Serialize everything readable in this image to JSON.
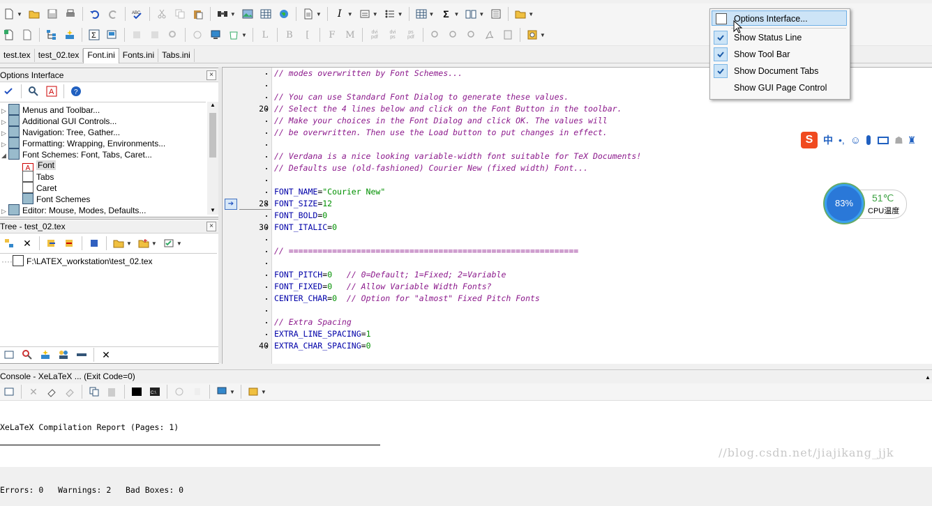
{
  "tabs": [
    {
      "label": "test.tex"
    },
    {
      "label": "test_02.tex"
    },
    {
      "label": "Font.ini",
      "active": true
    },
    {
      "label": "Fonts.ini"
    },
    {
      "label": "Tabs.ini"
    }
  ],
  "options_panel": {
    "title": "Options Interface",
    "items": [
      {
        "label": "Menus and Toolbar..."
      },
      {
        "label": "Additional GUI Controls..."
      },
      {
        "label": "Navigation: Tree, Gather..."
      },
      {
        "label": "Formatting: Wrapping, Environments..."
      },
      {
        "label": "Font Schemes: Font, Tabs, Caret..."
      },
      {
        "label": "Font"
      },
      {
        "label": "Tabs"
      },
      {
        "label": "Caret"
      },
      {
        "label": "Font Schemes"
      },
      {
        "label": "Editor: Mouse, Modes, Defaults..."
      }
    ]
  },
  "tree_panel": {
    "title": "Tree - test_02.tex",
    "file": "F:\\LATEX_workstation\\test_02.tex"
  },
  "editor": {
    "line_numbers": [
      "20",
      "28",
      "30",
      "40"
    ],
    "lines": [
      {
        "type": "comment",
        "text": "// modes overwritten by Font Schemes..."
      },
      {
        "type": "blank",
        "text": ""
      },
      {
        "type": "comment",
        "text": "// You can use Standard Font Dialog to generate these values."
      },
      {
        "type": "comment",
        "text": "// Select the 4 lines below and click on the Font Button in the toolbar."
      },
      {
        "type": "comment",
        "text": "// Make your choices in the Font Dialog and click OK. The values will"
      },
      {
        "type": "comment",
        "text": "// be overwritten. Then use the Load button to put changes in effect."
      },
      {
        "type": "blank",
        "text": ""
      },
      {
        "type": "comment",
        "text": "// Verdana is a nice looking variable-width font suitable for TeX Documents!"
      },
      {
        "type": "comment",
        "text": "// Defaults use (old-fashioned) Courier New (fixed width) Font..."
      },
      {
        "type": "blank",
        "text": ""
      },
      {
        "type": "kv",
        "key": "FONT_NAME",
        "value": "\"Courier New\"",
        "comment": ""
      },
      {
        "type": "kv",
        "key": "FONT_SIZE",
        "value": "12",
        "comment": ""
      },
      {
        "type": "kv",
        "key": "FONT_BOLD",
        "value": "0",
        "comment": ""
      },
      {
        "type": "kv",
        "key": "FONT_ITALIC",
        "value": "0",
        "comment": ""
      },
      {
        "type": "blank",
        "text": ""
      },
      {
        "type": "comment",
        "text": "// ============================================================"
      },
      {
        "type": "blank",
        "text": ""
      },
      {
        "type": "kv",
        "key": "FONT_PITCH",
        "value": "0",
        "comment": "   // 0=Default; 1=Fixed; 2=Variable"
      },
      {
        "type": "kv",
        "key": "FONT_FIXED",
        "value": "0",
        "comment": "   // Allow Variable Width Fonts?"
      },
      {
        "type": "kv",
        "key": "CENTER_CHAR",
        "value": "0",
        "comment": "  // Option for \"almost\" Fixed Pitch Fonts"
      },
      {
        "type": "blank",
        "text": ""
      },
      {
        "type": "comment",
        "text": "// Extra Spacing"
      },
      {
        "type": "kv",
        "key": "EXTRA_LINE_SPACING",
        "value": "1",
        "comment": ""
      },
      {
        "type": "kv",
        "key": "EXTRA_CHAR_SPACING",
        "value": "0",
        "comment": ""
      }
    ]
  },
  "console": {
    "title": "Console - XeLaTeX ... (Exit Code=0)",
    "report": "XeLaTeX Compilation Report (Pages: 1)",
    "stats": "Errors: 0   Warnings: 2   Bad Boxes: 0"
  },
  "context_menu": {
    "items": [
      {
        "label": "Options Interface...",
        "checked": false,
        "highlighted": true
      },
      {
        "label": "Show Status Line",
        "checked": true
      },
      {
        "label": "Show Tool Bar",
        "checked": true
      },
      {
        "label": "Show Document Tabs",
        "checked": true
      },
      {
        "label": "Show GUI Page Control",
        "checked": false
      }
    ]
  },
  "ime_bar": {
    "lang": "中"
  },
  "cpu_widget": {
    "percent": "83%",
    "temp": "51℃",
    "label": "CPU温度"
  },
  "watermark": "//blog.csdn.net/jiajikang_jjk",
  "colors": {
    "comment": "#8c1a8c",
    "keyword": "#0000a8",
    "value": "#009000",
    "menu_highlight": "#cde4f7"
  }
}
